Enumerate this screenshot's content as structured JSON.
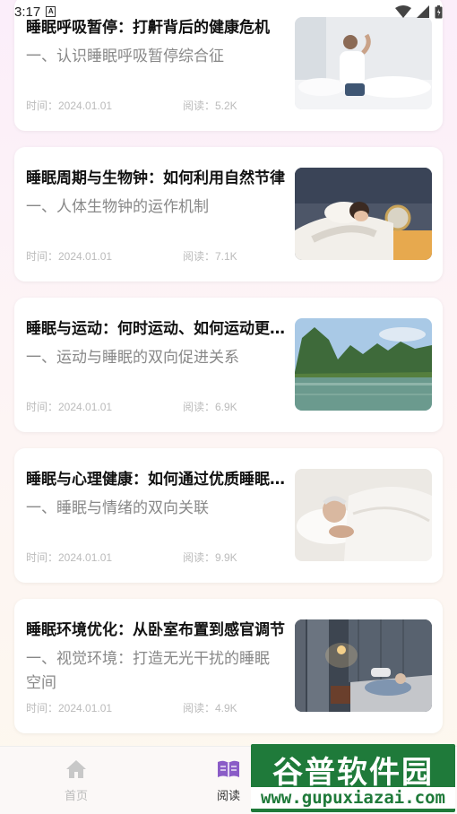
{
  "status_bar": {
    "time": "3:17",
    "notif_letter": "A"
  },
  "articles": [
    {
      "title": "睡眠呼吸暂停：打鼾背后的健康危机",
      "subtitle": "一、认识睡眠呼吸暂停综合征",
      "date": "时间：2024.01.01",
      "reads": "阅读：5.2K",
      "image": "man-stretching-back-in-bed"
    },
    {
      "title": "睡眠周期与生物钟：如何利用自然节律",
      "subtitle": "一、人体生物钟的运作机制",
      "date": "时间：2024.01.01",
      "reads": "阅读：7.1K",
      "image": "woman-sleeping-alarm-clock"
    },
    {
      "title": "睡眠与运动：何时运动、如何运动更助眠",
      "subtitle": "一、运动与睡眠的双向促进关系",
      "date": "时间：2024.01.01",
      "reads": "阅读：6.9K",
      "image": "river-karst-mountains"
    },
    {
      "title": "睡眠与心理健康：如何通过优质睡眠改善",
      "subtitle": "一、睡眠与情绪的双向关联",
      "date": "时间：2024.01.01",
      "reads": "阅读：9.9K",
      "image": "elderly-man-sleeping"
    },
    {
      "title": "睡眠环境优化：从卧室布置到感官调节",
      "subtitle": "一、视觉环境：打造无光干扰的睡眠空间",
      "date": "时间：2024.01.01",
      "reads": "阅读：4.9K",
      "image": "elderly-couple-dim-bedroom"
    }
  ],
  "tabbar": {
    "home_label": "首页",
    "read_label": "阅读",
    "home_icon": "home-icon",
    "read_icon": "book-icon",
    "active_color": "#8a5cc7",
    "inactive_color": "#bbbbbb"
  },
  "watermark": {
    "top": "谷普软件园",
    "bottom": "www.gupuxiazai.com"
  }
}
